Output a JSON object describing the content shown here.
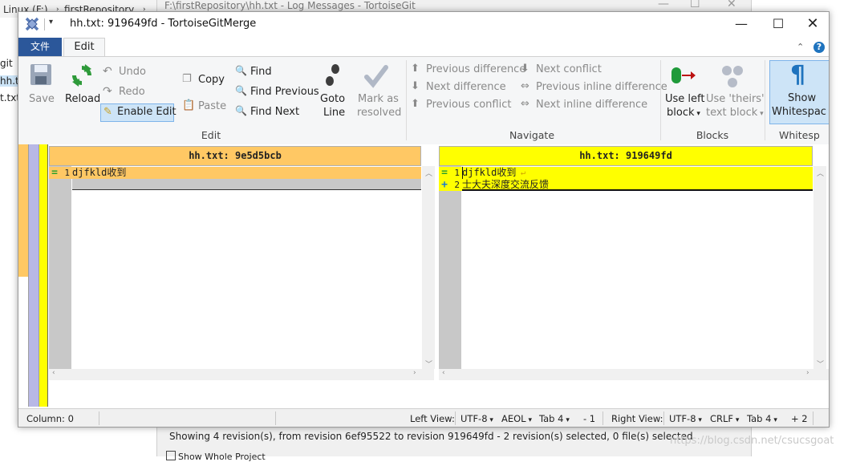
{
  "background": {
    "explorer_crumbs": [
      "Linux (F:)",
      "firstRepository"
    ],
    "explorer_files": [
      "git",
      "hh.tx",
      "t.txt"
    ],
    "log_window_title": "F:\\firstRepository\\hh.txt - Log Messages - TortoiseGit",
    "log_status": "Showing 4 revision(s), from revision 6ef95522 to revision 919649fd - 2 revision(s) selected, 0 file(s) selected",
    "show_whole_project": "Show Whole Project",
    "watermark": "https://blog.csdn.net/csucsgoat"
  },
  "window": {
    "title": "hh.txt: 919649fd - TortoiseGitMerge",
    "controls": {
      "minimize": "—",
      "maximize": "☐",
      "close": "✕"
    }
  },
  "ribbon": {
    "tabs": {
      "file": "文件",
      "edit": "Edit"
    },
    "collapse": "⌃",
    "help": "?",
    "groups": {
      "edit": {
        "label": "Edit",
        "save": "Save",
        "reload": "Reload",
        "undo": "Undo",
        "redo": "Redo",
        "enable_edit": "Enable Edit",
        "copy": "Copy",
        "paste": "Paste",
        "find": "Find",
        "find_previous": "Find Previous",
        "find_next": "Find Next",
        "goto_line_1": "Goto",
        "goto_line_2": "Line",
        "mark_resolved_1": "Mark as",
        "mark_resolved_2": "resolved"
      },
      "navigate": {
        "label": "Navigate",
        "previous_difference": "Previous difference",
        "next_difference": "Next difference",
        "previous_conflict": "Previous conflict",
        "next_conflict": "Next conflict",
        "previous_inline_difference": "Previous inline difference",
        "next_inline_difference": "Next inline difference"
      },
      "blocks": {
        "label": "Blocks",
        "use_left_1": "Use left",
        "use_left_2": "block",
        "use_theirs_1": "Use 'theirs'",
        "use_theirs_2": "text block"
      },
      "whitespace": {
        "label": "Whitesp",
        "show_1": "Show",
        "show_2": "Whitespac"
      }
    }
  },
  "left_pane": {
    "header": "hh.txt: 9e5d5bcb",
    "header_color": "#ffc864",
    "lines": [
      {
        "num": "1",
        "mark": "=",
        "text": "djfkld收到"
      }
    ]
  },
  "right_pane": {
    "header": "hh.txt: 919649fd",
    "header_color": "#ffff00",
    "lines": [
      {
        "num": "1",
        "mark": "=",
        "text": "djfkld收到",
        "eol": "↵"
      },
      {
        "num": "2",
        "mark": "+",
        "text": "士大夫深度交流反馈"
      }
    ]
  },
  "statusbar": {
    "column": "Column: 0",
    "left_view": "Left View:",
    "left_encoding": "UTF-8",
    "left_eol": "AEOL",
    "left_tab": "Tab 4",
    "left_count": "- 1",
    "right_view": "Right View:",
    "right_encoding": "UTF-8",
    "right_eol": "CRLF",
    "right_tab": "Tab 4",
    "right_count": "+ 2"
  },
  "colors": {
    "left_changed": "#ffc864",
    "right_added": "#ffff00",
    "equal_mark": "#2ca02c",
    "add_mark": "#1a7ad0",
    "file_tab": "#2b579a"
  }
}
